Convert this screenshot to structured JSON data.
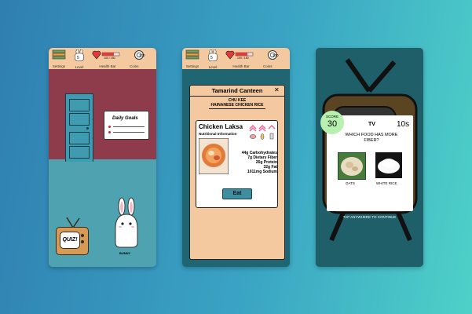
{
  "colors": {
    "bg_left": "#2f7fb0",
    "bg_right": "#4ed1c8",
    "topbar": "#f5c9a0",
    "wall": "#8e3c4b",
    "floor": "#4fa3b0",
    "health": "#e23b3b",
    "score_green": "#b8f0b0"
  },
  "topbar": {
    "settings_label": "Settings",
    "level_label": "Level",
    "level_value": "5",
    "health_label": "Health Bar",
    "health_value": "100 / 150",
    "coins_label": "Coins",
    "coins_value": "100"
  },
  "screen1": {
    "daily_goals": "Daily Goals",
    "tv_label": "QUIZ!",
    "bunny_label": "BUNNY",
    "help_label": "?",
    "icons": {
      "settings": "settings-stack-icon",
      "level": "bunny-face-icon",
      "health": "heart-icon",
      "coins": "coin-icon",
      "book": "open-book-icon",
      "help": "help-icon"
    }
  },
  "screen2": {
    "modal_title": "Tamarind Canteen",
    "close_label": "✕",
    "stall_name": "CHU KEE",
    "stall_subtitle": "HAINANESE CHICKEN RICE",
    "food_name": "Chicken Laksa",
    "nutrition_heading": "Nutritional Information",
    "nutrients": [
      "44g Carbohydrates",
      "7g Dietary Fiber",
      "26g Protein",
      "32g Fat",
      "1011mg Sodium"
    ],
    "eat_label": "Eat"
  },
  "screen3": {
    "score_label": "SCORE",
    "score_value": "30",
    "tv_label": "TV",
    "timer": "10s",
    "question": "WHICH FOOD HAS MORE FIBER?",
    "option_a": "OATS",
    "option_b": "WHITE RICE",
    "continue_label": "TAP ANYWHERE TO CONTINUE"
  }
}
